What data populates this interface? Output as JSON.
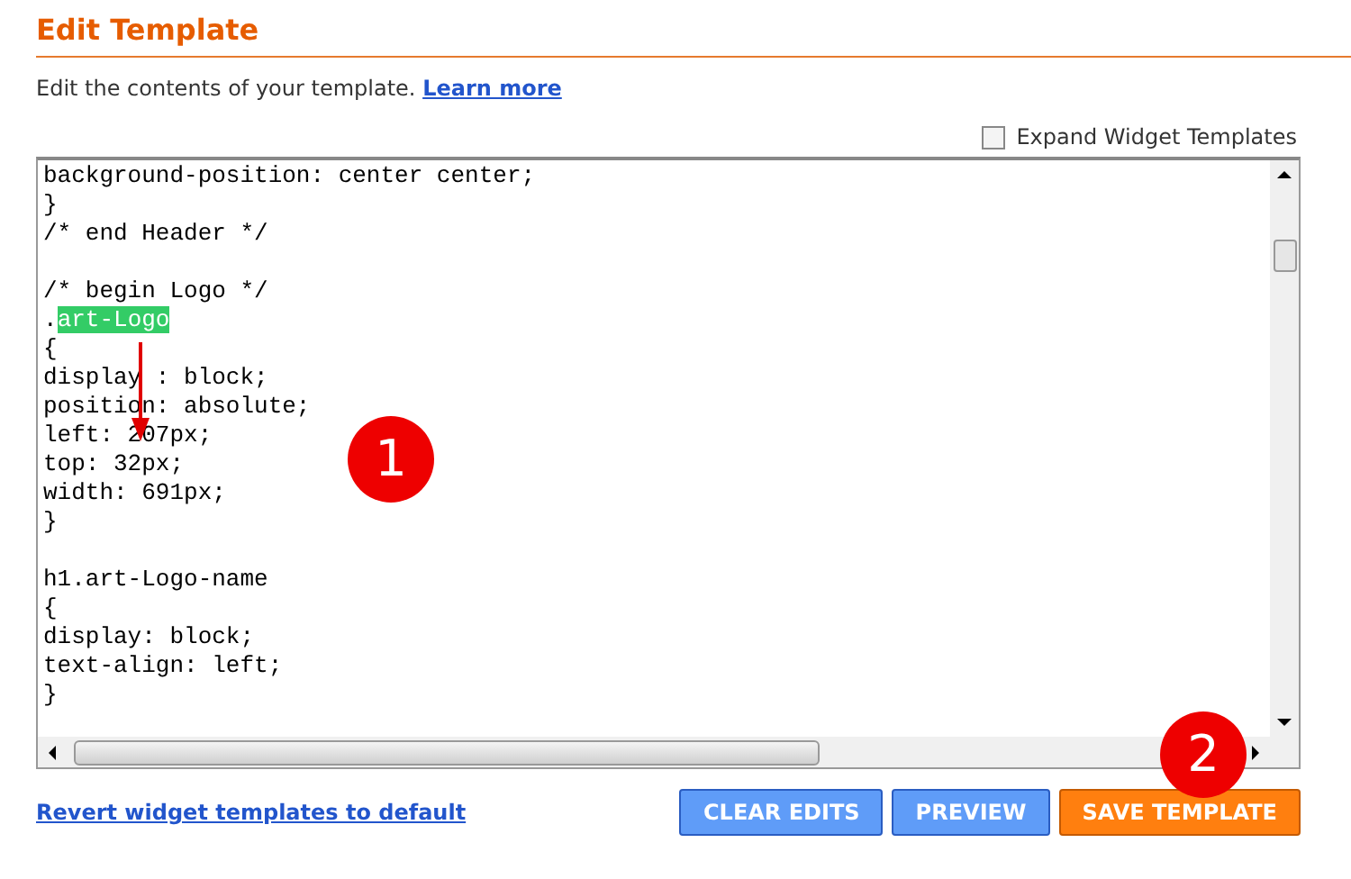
{
  "title": "Edit Template",
  "description": {
    "text": "Edit the contents of your template.",
    "link": "Learn more"
  },
  "expand_widget_templates": {
    "label": "Expand Widget Templates",
    "checked": false
  },
  "editor": {
    "lines": [
      {
        "kind": "code",
        "text": "background-position: center center;"
      },
      {
        "kind": "code",
        "text": "}"
      },
      {
        "kind": "code",
        "text": "/* end Header */"
      },
      {
        "kind": "blank"
      },
      {
        "kind": "code",
        "text": "/* begin Logo */"
      },
      {
        "kind": "code",
        "text": ".",
        "highlight": "art-Logo"
      },
      {
        "kind": "code",
        "text": "{"
      },
      {
        "kind": "code",
        "text": "display : block;"
      },
      {
        "kind": "code",
        "text": "position: absolute;"
      },
      {
        "kind": "code",
        "text": "left: 207px;"
      },
      {
        "kind": "code",
        "text": "top: 32px;"
      },
      {
        "kind": "code",
        "text": "width: 691px;"
      },
      {
        "kind": "code",
        "text": "}"
      },
      {
        "kind": "blank"
      },
      {
        "kind": "code",
        "text": "h1.art-Logo-name"
      },
      {
        "kind": "code",
        "text": "{"
      },
      {
        "kind": "code",
        "text": "display: block;"
      },
      {
        "kind": "code",
        "text": "text-align: left;"
      },
      {
        "kind": "code",
        "text": "}"
      }
    ]
  },
  "annotations": [
    {
      "kind": "marker",
      "label": "1"
    },
    {
      "kind": "marker",
      "label": "2"
    },
    {
      "kind": "arrow"
    }
  ],
  "revert_link": "Revert widget templates to default",
  "buttons": [
    {
      "label": "CLEAR EDITS",
      "kind": "secondary"
    },
    {
      "label": "PREVIEW",
      "kind": "secondary"
    },
    {
      "label": "SAVE TEMPLATE",
      "kind": "primary"
    }
  ]
}
